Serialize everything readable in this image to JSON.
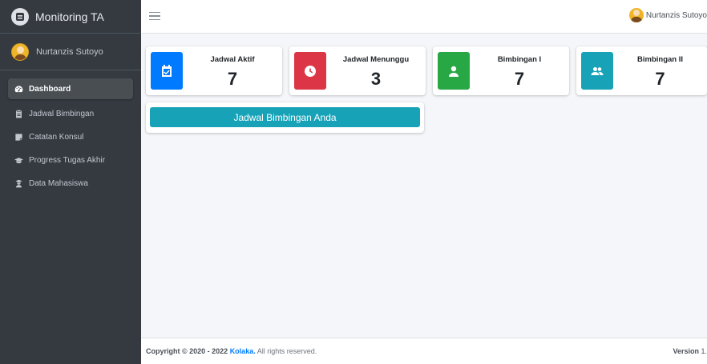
{
  "brand": {
    "title": "Monitoring TA"
  },
  "user": {
    "name": "Nurtanzis Sutoyo"
  },
  "sidebar": {
    "items": [
      {
        "label": "Dashboard",
        "icon": "tachometer-icon",
        "active": true
      },
      {
        "label": "Jadwal Bimbingan",
        "icon": "clipboard-icon"
      },
      {
        "label": "Catatan Konsul",
        "icon": "sticky-note-icon"
      },
      {
        "label": "Progress Tugas Akhir",
        "icon": "graduation-cap-icon"
      },
      {
        "label": "Data Mahasiswa",
        "icon": "user-graduate-icon"
      }
    ]
  },
  "topbar": {
    "user_name": "Nurtanzis Sutoyo"
  },
  "cards": [
    {
      "label": "Jadwal Aktif",
      "value": "7",
      "color": "#007bff",
      "icon": "calendar-check-icon"
    },
    {
      "label": "Jadwal Menunggu",
      "value": "3",
      "color": "#dc3545",
      "icon": "clock-icon"
    },
    {
      "label": "Bimbingan I",
      "value": "7",
      "color": "#28a745",
      "icon": "user-icon"
    },
    {
      "label": "Bimbingan II",
      "value": "7",
      "color": "#17a2b8",
      "icon": "users-icon"
    }
  ],
  "panel": {
    "button_label": "Jadwal Bimbingan Anda"
  },
  "footer": {
    "copyright": "Copyright © 2020 - 2022",
    "brand": "Kolaka.",
    "rights": "All rights reserved.",
    "version_label": "Version",
    "version_value": "1."
  }
}
